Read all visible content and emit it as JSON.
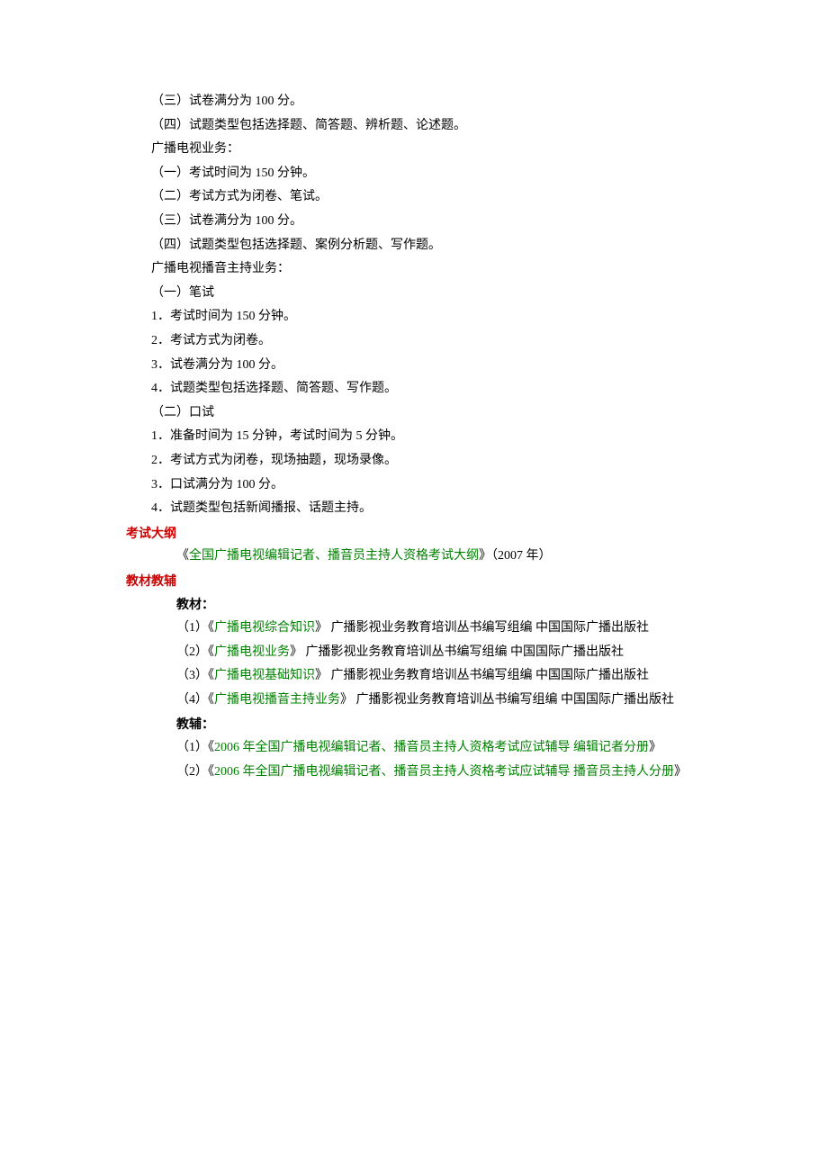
{
  "sections": {
    "s1_p1": "（三）试卷满分为 100 分。",
    "s1_p2": "（四）试题类型包括选择题、简答题、辨析题、论述题。",
    "s1_p3": "广播电视业务：",
    "s1_p4": "（一）考试时间为 150 分钟。",
    "s1_p5": "（二）考试方式为闭卷、笔试。",
    "s1_p6": "（三）试卷满分为 100 分。",
    "s1_p7": "（四）试题类型包括选择题、案例分析题、写作题。",
    "s1_p8": "广播电视播音主持业务：",
    "s1_p9": "（一）笔试",
    "s1_p10": "1．考试时间为 150 分钟。",
    "s1_p11": "2．考试方式为闭卷。",
    "s1_p12": "3．试卷满分为 100 分。",
    "s1_p13": "4．试题类型包括选择题、简答题、写作题。",
    "s1_p14": "（二）口试",
    "s1_p15": "1．准备时间为 15 分钟，考试时间为 5 分钟。",
    "s1_p16": "2．考试方式为闭卷，现场抽题，现场录像。",
    "s1_p17": "3．口试满分为 100 分。",
    "s1_p18": "4．试题类型包括新闻播报、话题主持。",
    "h_exam_outline": "考试大纲",
    "exam_outline_p1_pre": "《",
    "exam_outline_p1_link": "全国广播电视编辑记者、播音员主持人资格考试大纲",
    "exam_outline_p1_post": "》（2007 年）",
    "h_textbook": "教材教辅",
    "sub_textbook": "教材：",
    "tb1_pre": "（1）《",
    "tb1_link": "广播电视综合知识",
    "tb1_post": "》  广播影视业务教育培训丛书编写组编   中国国际广播出版社",
    "tb2_pre": "（2）《",
    "tb2_link": "广播电视业务",
    "tb2_post": "》  广播影视业务教育培训丛书编写组编   中国国际广播出版社",
    "tb3_pre": "（3）《",
    "tb3_link": "广播电视基础知识",
    "tb3_post": "》  广播影视业务教育培训丛书编写组编   中国国际广播出版社",
    "tb4_pre": "（4）《",
    "tb4_link": "广播电视播音主持业务",
    "tb4_post": "》  广播影视业务教育培训丛书编写组编   中国国际广播出版社",
    "sub_aid": "教辅：",
    "aid1_pre": "（1）《",
    "aid1_link": "2006 年全国广播电视编辑记者、播音员主持人资格考试应试辅导 编辑记者分册",
    "aid1_post": "》",
    "aid2_pre": "（2）《",
    "aid2_link": "2006 年全国广播电视编辑记者、播音员主持人资格考试应试辅导 播音员主持人分册",
    "aid2_post": "》"
  }
}
